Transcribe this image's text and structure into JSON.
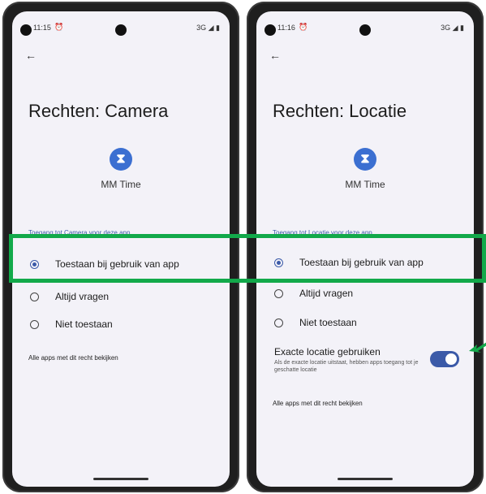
{
  "left_screen": {
    "status_time": "11:15",
    "status_network": "3G",
    "title": "Rechten: Camera",
    "app_name": "MM Time",
    "section_label": "Toegang tot Camera voor deze app",
    "options": [
      {
        "label": "Toestaan bij gebruik van app",
        "selected": true
      },
      {
        "label": "Altijd vragen",
        "selected": false
      },
      {
        "label": "Niet toestaan",
        "selected": false
      }
    ],
    "all_apps_link": "Alle apps met dit recht bekijken"
  },
  "right_screen": {
    "status_time": "11:16",
    "status_network": "3G",
    "title": "Rechten: Locatie",
    "app_name": "MM Time",
    "section_label": "Toegang tot Locatie voor deze app",
    "options": [
      {
        "label": "Toestaan bij gebruik van app",
        "selected": true
      },
      {
        "label": "Altijd vragen",
        "selected": false
      },
      {
        "label": "Niet toestaan",
        "selected": false
      }
    ],
    "exact_location": {
      "title": "Exacte locatie gebruiken",
      "subtitle": "Als de exacte locatie uitstaat, hebben apps toegang tot je geschatte locatie",
      "enabled": true
    },
    "all_apps_link": "Alle apps met dit recht bekijken"
  },
  "colors": {
    "accent": "#3b5aa8",
    "highlight": "#12a94a",
    "app_icon": "#3b6fd1"
  },
  "icons": {
    "back": "back-arrow-icon",
    "app": "hourglass-icon"
  }
}
